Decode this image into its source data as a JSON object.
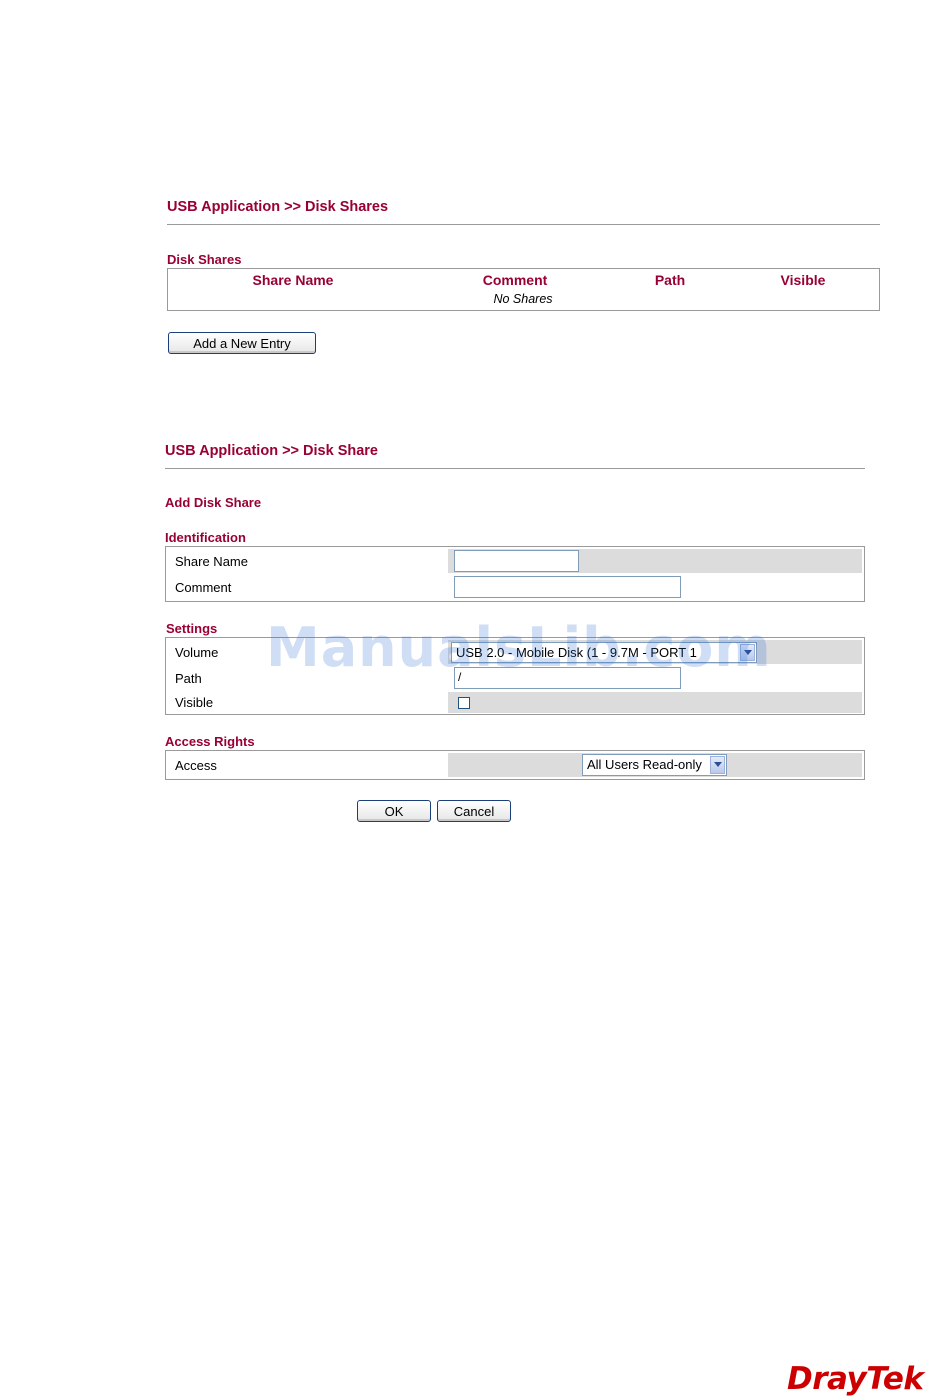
{
  "shares_page": {
    "breadcrumb": "USB Application >> Disk Shares",
    "section_label": "Disk Shares",
    "columns": [
      "Share Name",
      "Comment",
      "Path",
      "Visible"
    ],
    "empty_message": "No Shares",
    "add_button": "Add a New Entry"
  },
  "add_page": {
    "breadcrumb": "USB Application >> Disk Share",
    "heading": "Add Disk Share",
    "identification": {
      "label": "Identification",
      "share_name_label": "Share Name",
      "share_name_value": "",
      "comment_label": "Comment",
      "comment_value": ""
    },
    "settings": {
      "label": "Settings",
      "volume_label": "Volume",
      "volume_value": "USB 2.0 - Mobile Disk (1 - 9.7M - PORT 1",
      "path_label": "Path",
      "path_value": "/",
      "visible_label": "Visible",
      "visible_checked": false
    },
    "access_rights": {
      "label": "Access Rights",
      "access_label": "Access",
      "access_value": "All Users Read-only"
    },
    "ok_button": "OK",
    "cancel_button": "Cancel"
  },
  "watermark": "ManualsLib.com",
  "logo": "DrayTek"
}
